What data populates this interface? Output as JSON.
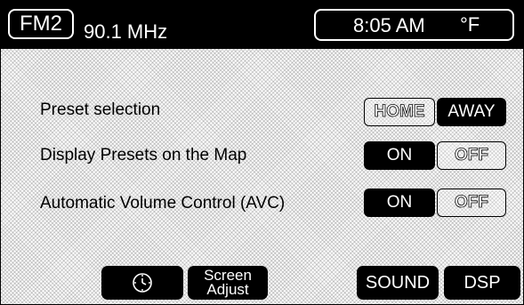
{
  "header": {
    "band_label": "FM2",
    "frequency": "90.1 MHz",
    "time": "8:05 AM",
    "temp_unit": "°F"
  },
  "settings": [
    {
      "label": "Preset selection",
      "options": [
        "HOME",
        "AWAY"
      ],
      "selected": "AWAY"
    },
    {
      "label": "Display Presets on the Map",
      "options": [
        "ON",
        "OFF"
      ],
      "selected": "ON"
    },
    {
      "label": "Automatic Volume Control (AVC)",
      "options": [
        "ON",
        "OFF"
      ],
      "selected": "ON"
    }
  ],
  "bottom_bar": {
    "clock_icon": "clock-icon",
    "screen_adjust_line1": "Screen",
    "screen_adjust_line2": "Adjust",
    "sound_label": "SOUND",
    "dsp_label": "DSP"
  },
  "colors": {
    "bar_background": "#000000",
    "selected_button": "#000000",
    "selected_text": "#ffffff",
    "screen_background": "#dcdcdc"
  }
}
